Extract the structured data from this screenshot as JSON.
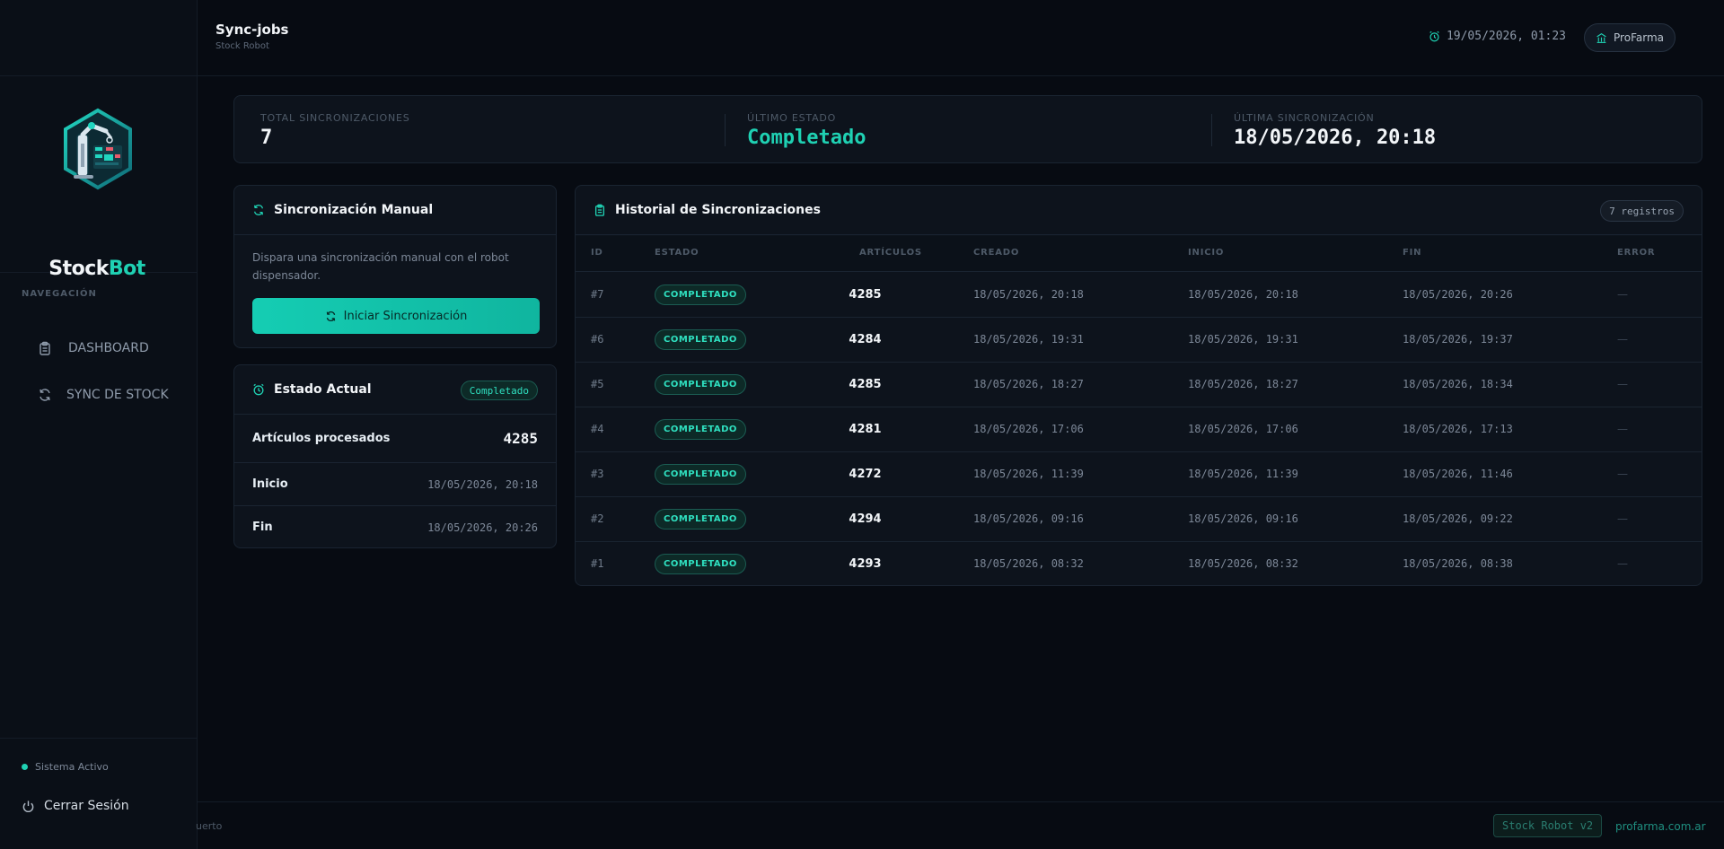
{
  "brand": {
    "name_part1": "Stock",
    "name_part2": "Bot",
    "accent": "#1fd1b3"
  },
  "header": {
    "title": "Sync-jobs",
    "subtitle": "Stock Robot",
    "datetime": "19/05/2026, 01:23",
    "org": "ProFarma"
  },
  "sidebar": {
    "section_label": "NAVEGACIÓN",
    "items": [
      {
        "label": "DASHBOARD",
        "icon": "clipboard-icon"
      },
      {
        "label": "SYNC DE STOCK",
        "icon": "refresh-icon"
      }
    ],
    "status": "Sistema Activo",
    "logout": "Cerrar Sesión"
  },
  "stats": [
    {
      "label": "TOTAL SINCRONIZACIONES",
      "value": "7",
      "color": "#f2f5f8"
    },
    {
      "label": "ÚLTIMO ESTADO",
      "value": "Completado",
      "color": "#1fd1b3"
    },
    {
      "label": "ÚLTIMA SINCRONIZACIÓN",
      "value": "18/05/2026, 20:18",
      "color": "#f2f5f8"
    }
  ],
  "manual": {
    "title": "Sincronización Manual",
    "description": "Dispara una sincronización manual con el robot dispensador.",
    "button": "Iniciar Sincronización"
  },
  "current": {
    "title": "Estado Actual",
    "badge": "Completado",
    "rows": [
      {
        "label": "Artículos procesados",
        "value": "4285"
      },
      {
        "label": "Inicio",
        "value": "18/05/2026, 20:18"
      },
      {
        "label": "Fin",
        "value": "18/05/2026, 20:26"
      }
    ]
  },
  "history": {
    "title": "Historial de Sincronizaciones",
    "count": "7 registros",
    "columns": [
      "ID",
      "ESTADO",
      "ARTÍCULOS",
      "CREADO",
      "INICIO",
      "FIN",
      "ERROR"
    ],
    "rows": [
      {
        "id": "#7",
        "estado": "COMPLETADO",
        "articulos": "4285",
        "creado": "18/05/2026, 20:18",
        "inicio": "18/05/2026, 20:18",
        "fin": "18/05/2026, 20:26",
        "error": "—"
      },
      {
        "id": "#6",
        "estado": "COMPLETADO",
        "articulos": "4284",
        "creado": "18/05/2026, 19:31",
        "inicio": "18/05/2026, 19:31",
        "fin": "18/05/2026, 19:37",
        "error": "—"
      },
      {
        "id": "#5",
        "estado": "COMPLETADO",
        "articulos": "4285",
        "creado": "18/05/2026, 18:27",
        "inicio": "18/05/2026, 18:27",
        "fin": "18/05/2026, 18:34",
        "error": "—"
      },
      {
        "id": "#4",
        "estado": "COMPLETADO",
        "articulos": "4281",
        "creado": "18/05/2026, 17:06",
        "inicio": "18/05/2026, 17:06",
        "fin": "18/05/2026, 17:13",
        "error": "—"
      },
      {
        "id": "#3",
        "estado": "COMPLETADO",
        "articulos": "4272",
        "creado": "18/05/2026, 11:39",
        "inicio": "18/05/2026, 11:39",
        "fin": "18/05/2026, 11:46",
        "error": "—"
      },
      {
        "id": "#2",
        "estado": "COMPLETADO",
        "articulos": "4294",
        "creado": "18/05/2026, 09:16",
        "inicio": "18/05/2026, 09:16",
        "fin": "18/05/2026, 09:22",
        "error": "—"
      },
      {
        "id": "#1",
        "estado": "COMPLETADO",
        "articulos": "4293",
        "creado": "18/05/2026, 08:32",
        "inicio": "18/05/2026, 08:32",
        "fin": "18/05/2026, 08:38",
        "error": "—"
      }
    ]
  },
  "footer": {
    "left_text": "uerto",
    "version": "Stock Robot v2",
    "link": "profarma.com.ar"
  }
}
